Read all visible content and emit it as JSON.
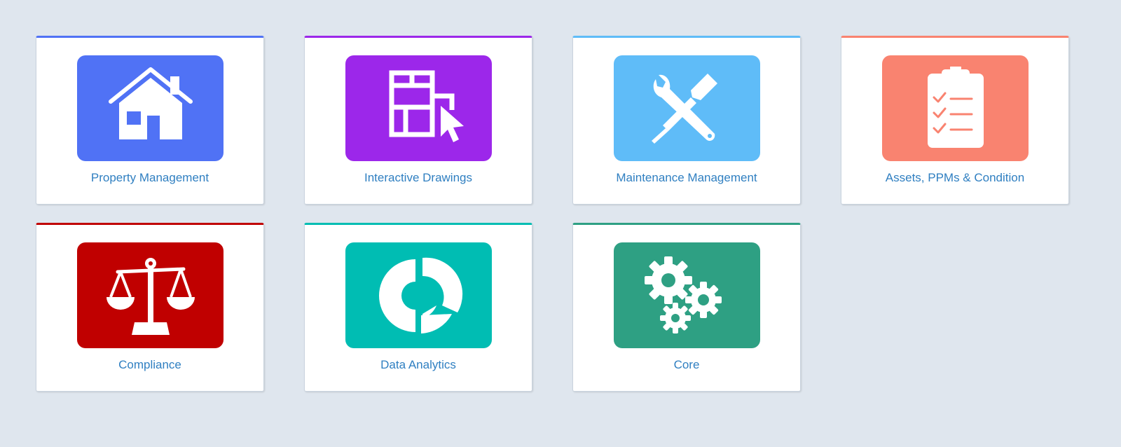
{
  "modules": [
    {
      "label": "Property Management",
      "color": "#5072f5",
      "icon": "house-icon"
    },
    {
      "label": "Interactive Drawings",
      "color": "#9c27ea",
      "icon": "floorplan-cursor-icon"
    },
    {
      "label": "Maintenance Management",
      "color": "#5fbcf8",
      "icon": "wrench-screwdriver-icon"
    },
    {
      "label": "Assets, PPMs & Condition",
      "color": "#f98370",
      "icon": "clipboard-checklist-icon"
    },
    {
      "label": "Compliance",
      "color": "#c00000",
      "icon": "scales-icon"
    },
    {
      "label": "Data Analytics",
      "color": "#00bdb3",
      "icon": "donut-chart-icon"
    },
    {
      "label": "Core",
      "color": "#2ea083",
      "icon": "gears-icon"
    }
  ]
}
